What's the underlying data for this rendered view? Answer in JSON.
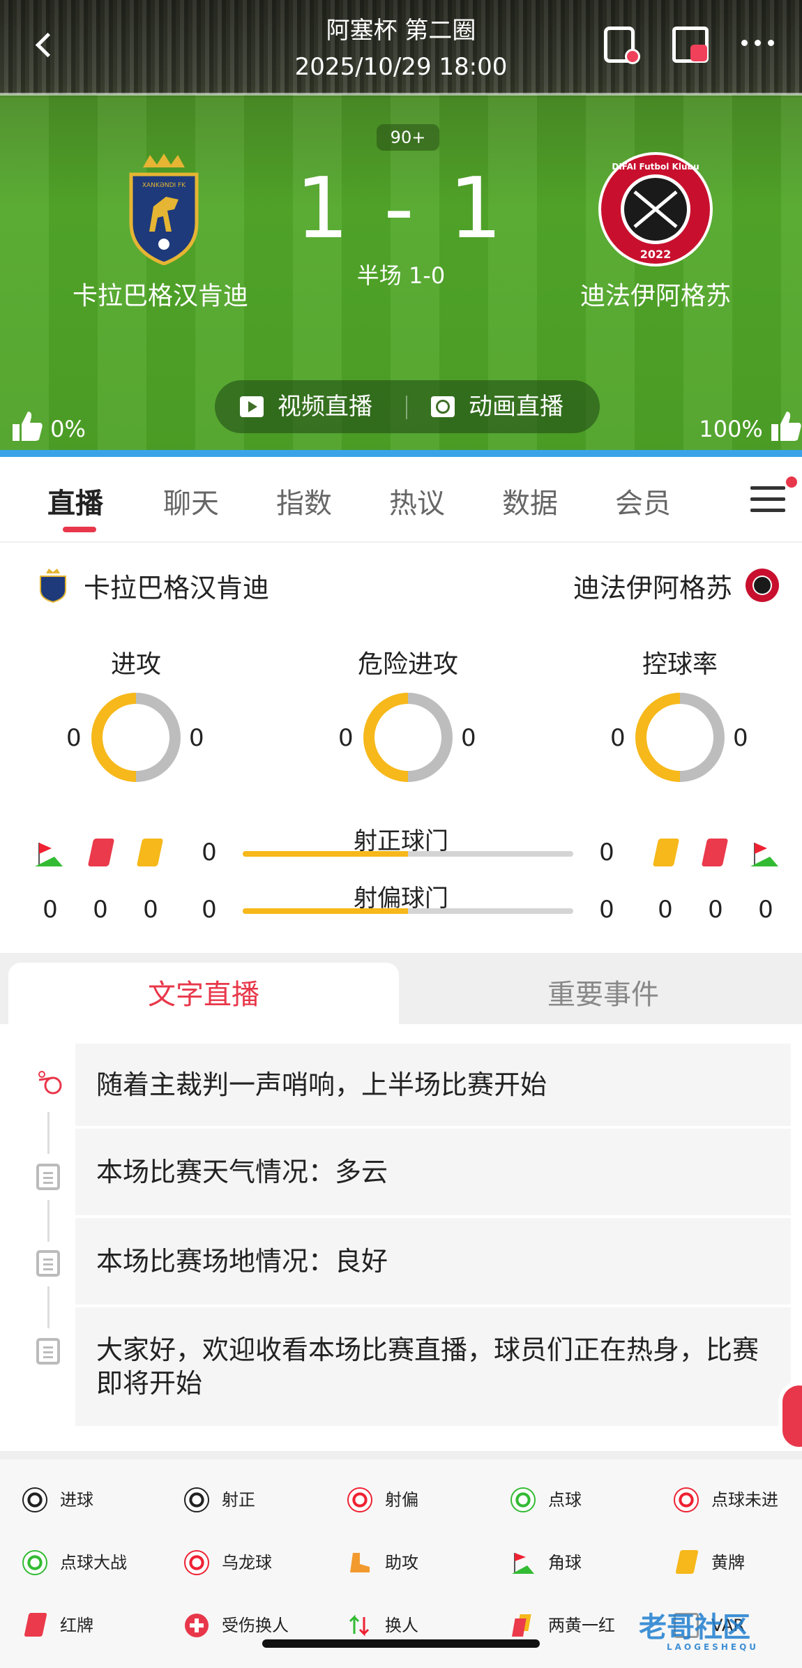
{
  "header": {
    "title": "阿塞杯 第二圈",
    "datetime": "2025/10/29 18:00"
  },
  "match": {
    "minute": "90+",
    "score": "1 - 1",
    "halftime": "半场 1-0",
    "home_team": "卡拉巴格汉肯迪",
    "away_team": "迪法伊阿格苏",
    "home_logo_text": "XANKƏNDI FK",
    "away_logo_text": "DIFAI Futbol Klubu",
    "away_logo_year": "2022"
  },
  "live": {
    "video_label": "视频直播",
    "animation_label": "动画直播"
  },
  "vote": {
    "home_pct": "0%",
    "away_pct": "100%"
  },
  "tabs": {
    "items": [
      "直播",
      "聊天",
      "指数",
      "热议",
      "数据",
      "会员"
    ],
    "active": "直播"
  },
  "stats": {
    "home_team": "卡拉巴格汉肯迪",
    "away_team": "迪法伊阿格苏",
    "donuts": [
      {
        "title": "进攻",
        "home": "0",
        "away": "0"
      },
      {
        "title": "危险进攻",
        "home": "0",
        "away": "0"
      },
      {
        "title": "控球率",
        "home": "0",
        "away": "0"
      }
    ],
    "shots_on_target": {
      "label": "射正球门",
      "home": "0",
      "away": "0",
      "home_share": 0.5
    },
    "shots_off_target": {
      "label": "射偏球门",
      "home": "0",
      "away": "0",
      "home_share": 0.5
    },
    "home_counts": {
      "corners": "0",
      "red": "0",
      "yellow": "0"
    },
    "away_counts": {
      "yellow": "0",
      "red": "0",
      "corners": "0"
    }
  },
  "subtabs": {
    "text_live": "文字直播",
    "key_events": "重要事件"
  },
  "feed": [
    {
      "icon": "whistle-icon",
      "text": "随着主裁判一声哨响，上半场比赛开始"
    },
    {
      "icon": "clipboard-icon",
      "text": "本场比赛天气情况：多云"
    },
    {
      "icon": "clipboard-icon",
      "text": "本场比赛场地情况：良好"
    },
    {
      "icon": "clipboard-icon",
      "text": "大家好，欢迎收看本场比赛直播，球员们正在热身，比赛即将开始"
    }
  ],
  "legend": [
    {
      "icon": "goal-ball-icon",
      "label": "进球"
    },
    {
      "icon": "shot-on-icon",
      "label": "射正"
    },
    {
      "icon": "shot-off-icon",
      "label": "射偏"
    },
    {
      "icon": "penalty-icon",
      "label": "点球"
    },
    {
      "icon": "penalty-miss-icon",
      "label": "点球未进"
    },
    {
      "icon": "shootout-icon",
      "label": "点球大战"
    },
    {
      "icon": "own-goal-icon",
      "label": "乌龙球"
    },
    {
      "icon": "assist-boot-icon",
      "label": "助攻"
    },
    {
      "icon": "corner-flag-icon",
      "label": "角球"
    },
    {
      "icon": "yellow-card-icon",
      "label": "黄牌"
    },
    {
      "icon": "red-card-icon",
      "label": "红牌"
    },
    {
      "icon": "injury-sub-icon",
      "label": "受伤换人"
    },
    {
      "icon": "substitution-icon",
      "label": "换人"
    },
    {
      "icon": "second-yellow-icon",
      "label": "两黄一红"
    },
    {
      "icon": "var-icon",
      "label": "VAR"
    }
  ],
  "watermark": {
    "main": "老哥社区",
    "sub": "LAOGESHEQU"
  },
  "colors": {
    "accent": "#e8374a",
    "bar_fill": "#f6b81a",
    "bar_track": "#d4d4d4",
    "pitch": "#4da126",
    "hero_strip": "#3aa3e8"
  }
}
